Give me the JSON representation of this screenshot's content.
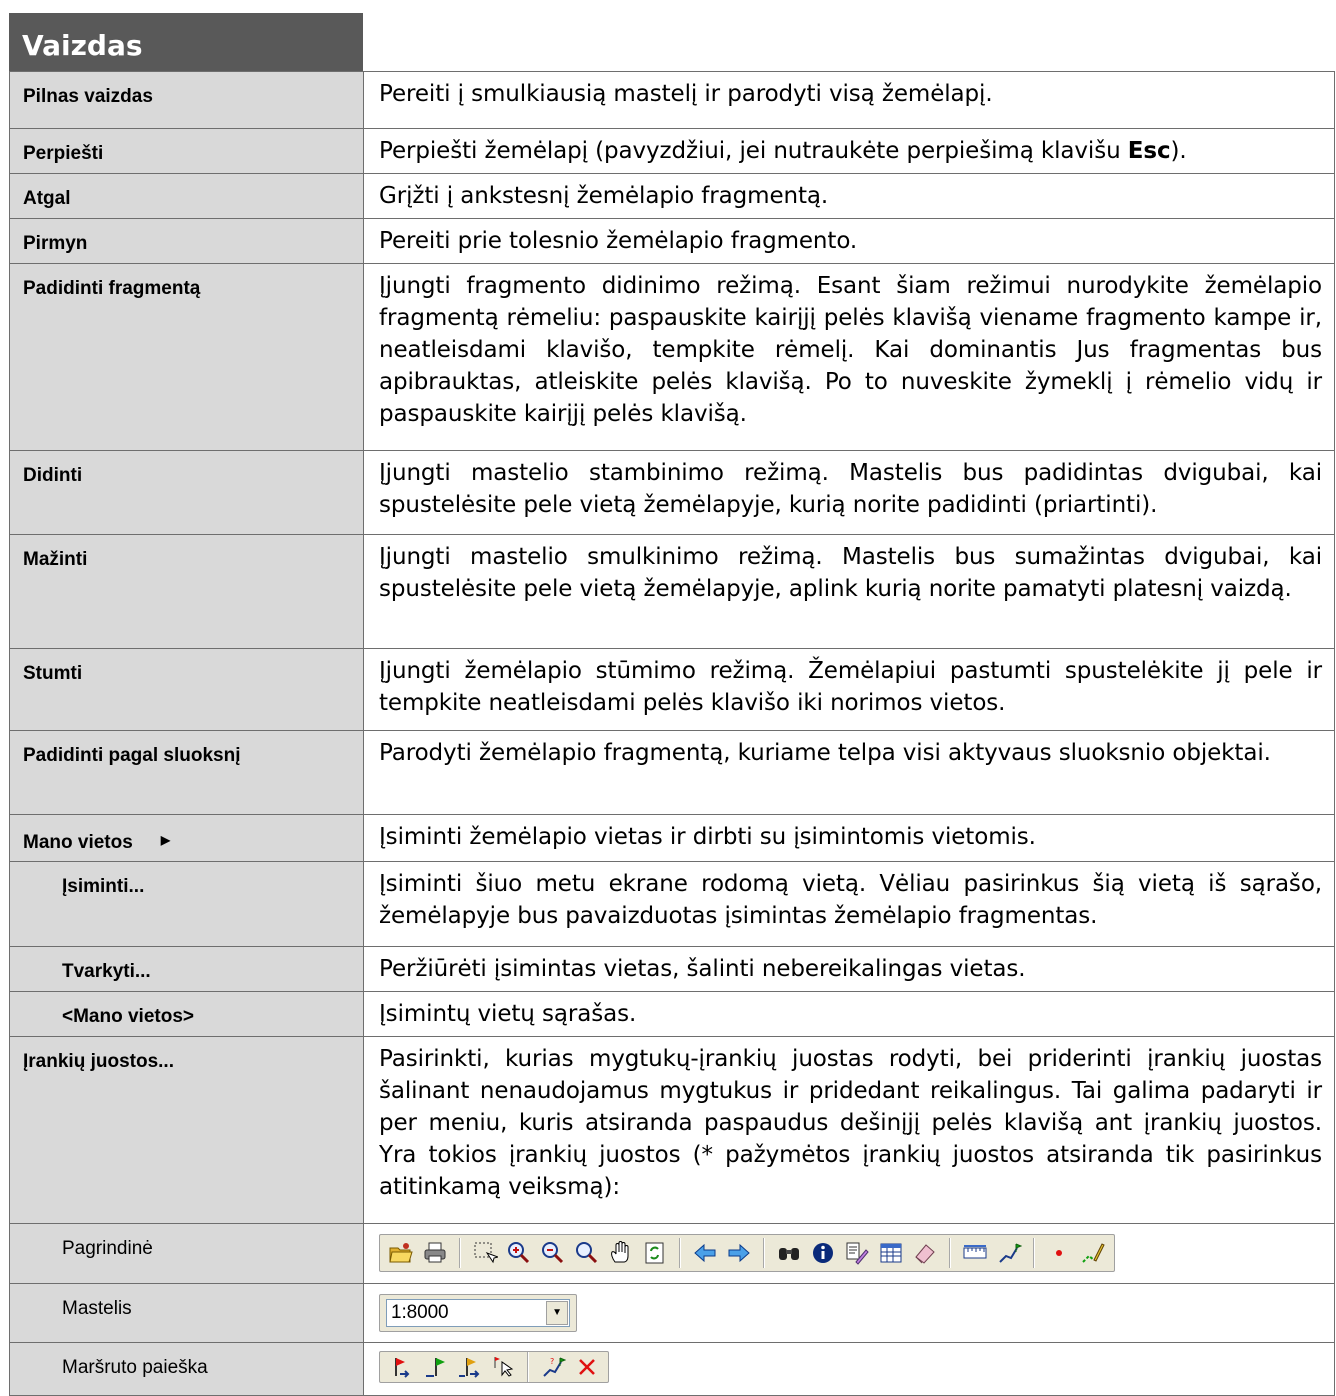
{
  "header": {
    "title": "Vaizdas"
  },
  "rows": [
    {
      "label": "Pilnas vaizdas",
      "desc": "Pereiti į smulkiausią mastelį ir parodyti visą žemėlapį."
    },
    {
      "label": "Perpiešti",
      "desc_before": "Perpiešti žemėlapį (pavyzdžiui, jei nutraukėte perpiešimą klavišu ",
      "desc_bold": "Esc",
      "desc_after": ")."
    },
    {
      "label": "Atgal",
      "desc": "Grįžti į ankstesnį žemėlapio fragmentą."
    },
    {
      "label": "Pirmyn",
      "desc": "Pereiti prie tolesnio žemėlapio fragmento."
    },
    {
      "label": "Padidinti fragmentą",
      "desc": "Įjungti fragmento didinimo režimą. Esant šiam režimui nurodykite žemėlapio fragmentą rėmeliu: paspauskite kairįjį pelės klavišą viename fragmento kampe ir, neatleisdami klavišo, tempkite rėmelį. Kai dominantis Jus fragmentas bus apibrauktas, atleiskite pelės klavišą. Po to nuveskite žymeklį į rėmelio vidų ir paspauskite kairįjį pelės klavišą."
    },
    {
      "label": "Didinti",
      "desc": "Įjungti mastelio stambinimo režimą. Mastelis bus padidintas dvigubai, kai spustelėsite pele vietą žemėlapyje, kurią norite padidinti (priartinti)."
    },
    {
      "label": "Mažinti",
      "desc": "Įjungti mastelio smulkinimo režimą. Mastelis bus sumažintas dvigubai, kai spustelėsite pele vietą žemėlapyje, aplink kurią norite pamatyti platesnį vaizdą."
    },
    {
      "label": "Stumti",
      "desc": "Įjungti žemėlapio stūmimo režimą. Žemėlapiui pastumti spustelėkite jį pele ir tempkite neatleisdami pelės klavišo iki norimos vietos."
    },
    {
      "label": "Padidinti pagal sluoksnį",
      "desc": "Parodyti žemėlapio fragmentą, kuriame telpa visi aktyvaus sluoksnio objektai."
    },
    {
      "label": "Mano vietos",
      "desc": "Įsiminti žemėlapio vietas ir dirbti su įsimintomis vietomis."
    },
    {
      "label": "Įsiminti...",
      "desc": "Įsiminti šiuo metu ekrane rodomą vietą. Vėliau pasirinkus šią vietą iš sąrašo, žemėlapyje bus pavaizduotas įsimintas žemėlapio fragmentas."
    },
    {
      "label": "Tvarkyti...",
      "desc": "Peržiūrėti įsimintas vietas, šalinti nebereikalingas vietas."
    },
    {
      "label": "<Mano vietos>",
      "desc": "Įsimintų vietų sąrašas."
    },
    {
      "label": "Įrankių juostos...",
      "desc": "Pasirinkti, kurias mygtukų-įrankių juostas rodyti, bei priderinti įrankių juostas šalinant nenaudojamus mygtukus ir pridedant reikalingus. Tai galima padaryti ir per meniu, kuris atsiranda paspaudus dešinįjį pelės klavišą ant įrankių juostos. Yra tokios įrankių juostos (* pažymėtos įrankių juostos atsiranda tik pasirinkus atitinkamą veiksmą):"
    },
    {
      "label": "Pagrindinė"
    },
    {
      "label": "Mastelis",
      "scale_value": "1:8000"
    },
    {
      "label": "Maršruto paieška"
    }
  ],
  "colors": {
    "header_bg": "#595959",
    "label_bg": "#d9d9d9",
    "border": "#6e6e6e"
  }
}
